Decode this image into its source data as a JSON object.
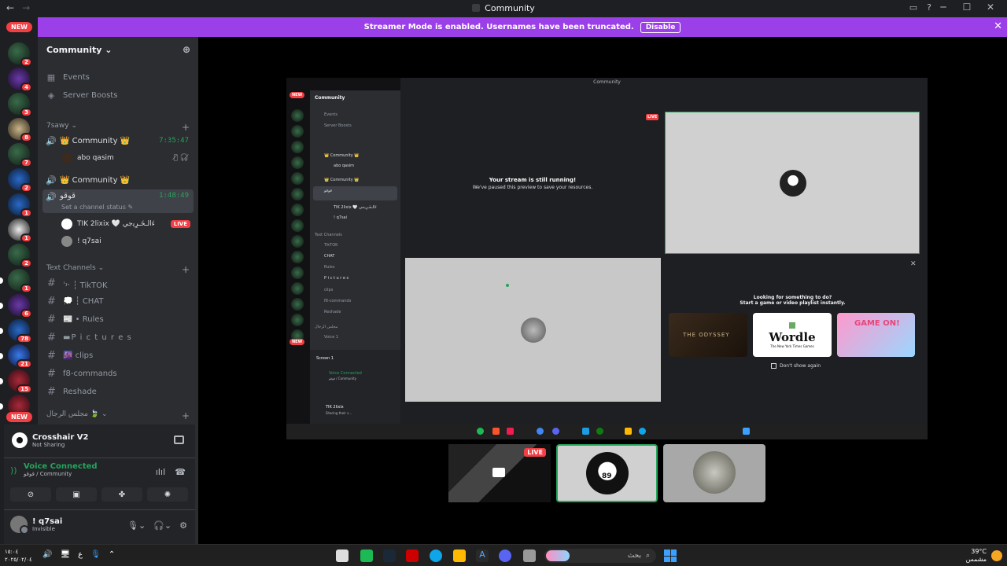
{
  "window": {
    "title": "Community",
    "nav_back": "←",
    "nav_forward": "→",
    "controls": {
      "minimize": "─",
      "maximize": "☐",
      "close": "✕",
      "inbox": "▭",
      "help": "?"
    }
  },
  "streamer_banner": {
    "text": "Streamer Mode is enabled. Usernames have been truncated.",
    "button": "Disable",
    "close": "✕"
  },
  "guilds": {
    "new_label": "NEW",
    "items": [
      {
        "badge": "2"
      },
      {
        "badge": "4"
      },
      {
        "badge": "3"
      },
      {
        "badge": "8"
      },
      {
        "badge": "7"
      },
      {
        "badge": "2"
      },
      {
        "badge": "1"
      },
      {
        "badge": "1"
      },
      {
        "badge": "2"
      },
      {
        "badge": "1"
      },
      {
        "badge": "6"
      },
      {
        "badge": "78"
      },
      {
        "badge": "21"
      },
      {
        "badge": "15"
      },
      {
        "badge": ""
      }
    ]
  },
  "sidebar": {
    "server_name": "Community",
    "invite_icon": "add-person-icon",
    "links": [
      {
        "icon": "calendar-icon",
        "label": "Events"
      },
      {
        "icon": "boost-icon",
        "label": "Server Boosts"
      }
    ],
    "category_7sawy": "7sawy",
    "voice_channels": [
      {
        "label": "👑 Community 👑",
        "time": "7:35:47",
        "users": [
          {
            "name": "abo qasim",
            "status_icons": "🎙̸ 🎧̸"
          }
        ]
      },
      {
        "label": "👑 Community 👑",
        "time": "",
        "users": []
      },
      {
        "label": "قوقو",
        "time": "1:48:49",
        "sub": "Set a channel status ✎",
        "users": [
          {
            "name": "TIK 2lixix 🤍 ءَالـخَـرِﻳجي",
            "live": "LIVE"
          },
          {
            "name": "! q7sai"
          }
        ]
      }
    ],
    "text_category": "Text Channels",
    "text_channels": [
      "ˈ᠈ˑ ┆ TikTOK",
      "💭 ┆ CHAT",
      "📰 • Rules",
      "▬P i c t u r e s",
      "🌆 clips",
      "f8-commands",
      "Reshade"
    ],
    "category_bottom": "مجلس الرجال 🍃"
  },
  "user_panel": {
    "activity_name": "Crosshair V2",
    "activity_status": "Not Sharing",
    "voice_status": "Voice Connected",
    "voice_location": "قوقو / Community",
    "username": "! q7sai",
    "user_status": "Invisible"
  },
  "stream": {
    "inner_title": "Community",
    "paused_title": "Your stream is still running!",
    "paused_sub": "We've paused this preview to save your resources.",
    "live": "LIVE",
    "activity_prompt_1": "Looking for something to do?",
    "activity_prompt_2": "Start a game or video playlist instantly.",
    "games": [
      "THE ODYSSEY",
      "Wordle",
      "GAME ON!"
    ],
    "wordle_sub": "The New York Times Games",
    "dont_show": "Don't show again",
    "inner_screen_label": "Screen 1",
    "inner_vc": "Voice Connected",
    "inner_vc_loc": "قوقو / Community",
    "inner_user": "TIK 2lixix",
    "inner_user_sub": "Sharing their s...",
    "inner_server": "Community",
    "inner_links": [
      "Events",
      "Server Boosts"
    ],
    "inner_voice_users": [
      "abo qasim",
      "TIK 2lixix 🤍 ءَالـخَـرِﻳجي",
      "! q7sai"
    ],
    "inner_text_channels": [
      "TikTOK",
      "CHAT",
      "Rules",
      "P i c t u r e s",
      "clips",
      "f8-commands",
      "Reshade"
    ],
    "inner_bottom_cat": "مجلس الرجال",
    "inner_voice_last": "Voice 1"
  },
  "thumbnails": {
    "live": "LIVE",
    "jersey_number": "89"
  },
  "taskbar": {
    "clock_time": "١٥:٠٤",
    "clock_date": "٢٠٢٥/٠٢/٠٤",
    "lang": "ع",
    "search": "بحث",
    "weather_temp": "39°C",
    "weather_desc": "مشمس"
  }
}
